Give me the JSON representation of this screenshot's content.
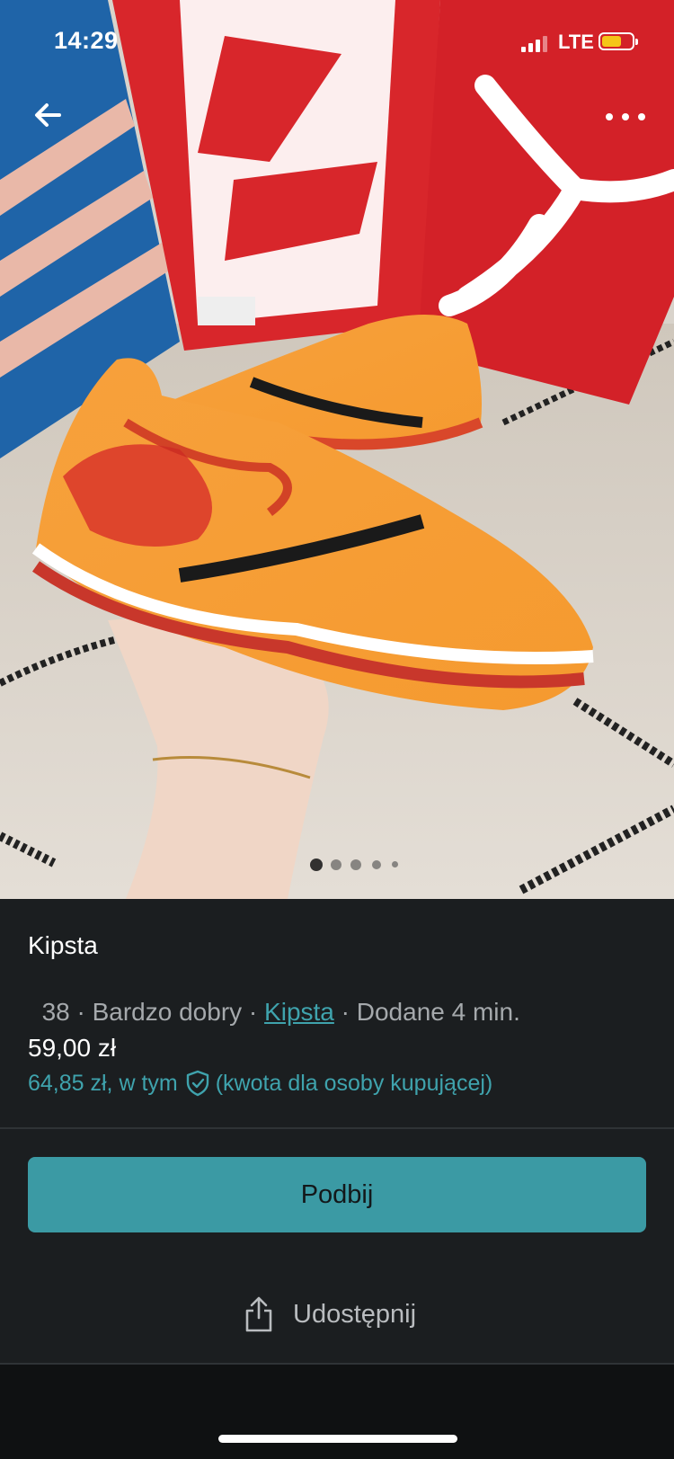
{
  "status_bar": {
    "time": "14:29",
    "network": "LTE",
    "battery_color": "#f5c518"
  },
  "header": {
    "back_icon": "arrow-left-icon",
    "more_icon": "more-horizontal-icon"
  },
  "gallery": {
    "photo_count": 5,
    "active_index": 0
  },
  "item": {
    "title": "Kipsta",
    "size": "38",
    "condition": "Bardzo dobry",
    "brand": "Kipsta",
    "added": "Dodane 4 min.",
    "separator": " · ",
    "price": "59,00 zł",
    "total_price": "64,85 zł, w tym",
    "total_note": "(kwota dla osoby kupującej)",
    "protection_icon": "shield-check-icon"
  },
  "actions": {
    "bump_label": "Podbij",
    "share_label": "Udostępnij",
    "share_icon": "share-icon"
  },
  "colors": {
    "accent": "#3b9aa4",
    "link": "#3fa3ad",
    "background": "#1b1e20"
  }
}
